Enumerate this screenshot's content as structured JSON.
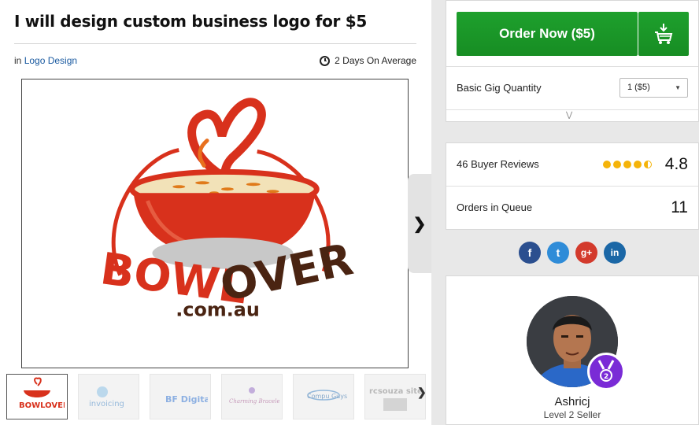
{
  "gig": {
    "title": "I will design custom business logo for $5",
    "category_prefix": "in",
    "category": "Logo Design",
    "delivery": "2 Days On Average"
  },
  "main_image": {
    "logo_word_left": "BOWL",
    "logo_word_right": "OVER",
    "logo_domain": ".com.au",
    "colors": {
      "red": "#d8311c",
      "brown": "#4a2412"
    }
  },
  "thumbnails": [
    {
      "label": "BOWLOVER",
      "active": true
    },
    {
      "label": "invoicing",
      "active": false
    },
    {
      "label": "BF Digital",
      "active": false
    },
    {
      "label": "Charming Bracelets",
      "active": false
    },
    {
      "label": "Compu Guys",
      "active": false
    },
    {
      "label": "rcsouza site",
      "active": false
    }
  ],
  "order": {
    "button_label": "Order Now ($5)",
    "cart_icon": "cart-icon",
    "quantity_label": "Basic Gig Quantity",
    "quantity_value": "1 ($5)",
    "accent": "#1a9a28"
  },
  "stats": {
    "reviews_label": "46 Buyer Reviews",
    "rating": "4.8",
    "rating_stars": 4.5,
    "queue_label": "Orders in Queue",
    "queue_value": "11"
  },
  "social": [
    {
      "name": "facebook",
      "glyph": "f"
    },
    {
      "name": "twitter",
      "glyph": "t"
    },
    {
      "name": "google-plus",
      "glyph": "g+"
    },
    {
      "name": "linkedin",
      "glyph": "in"
    }
  ],
  "seller": {
    "name": "Ashricj",
    "level": "Level 2 Seller",
    "badge_color": "#7a2bd6"
  }
}
